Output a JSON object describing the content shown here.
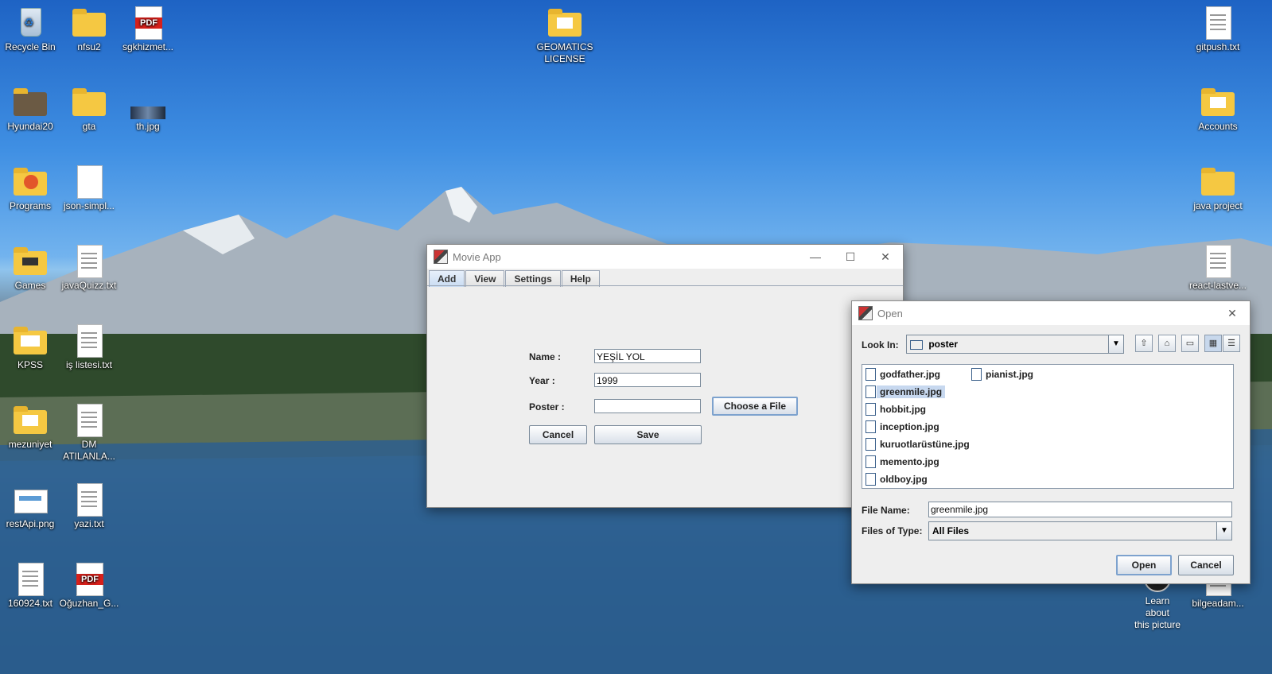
{
  "desktop": {
    "icons_left": [
      {
        "label": "Recycle Bin",
        "kind": "bin"
      },
      {
        "label": "nfsu2",
        "kind": "folder"
      },
      {
        "label": "sgkhizmet...",
        "kind": "pdf"
      },
      {
        "label": "Hyundai20",
        "kind": "folder"
      },
      {
        "label": "gta",
        "kind": "folder"
      },
      {
        "label": "th.jpg",
        "kind": "image"
      },
      {
        "label": "Programs",
        "kind": "folder"
      },
      {
        "label": "json-simpl...",
        "kind": "doc"
      },
      {
        "label": "Games",
        "kind": "folder"
      },
      {
        "label": "javaQuizz.txt",
        "kind": "doc"
      },
      {
        "label": "KPSS",
        "kind": "folder"
      },
      {
        "label": "iş listesi.txt",
        "kind": "doc"
      },
      {
        "label": "mezuniyet",
        "kind": "folder"
      },
      {
        "label": "DM ATILANLA...",
        "kind": "doc"
      },
      {
        "label": "restApi.png",
        "kind": "image"
      },
      {
        "label": "yazi.txt",
        "kind": "doc"
      },
      {
        "label": "160924.txt",
        "kind": "doc"
      },
      {
        "label": "Oğuzhan_G...",
        "kind": "pdf"
      }
    ],
    "icons_center": [
      {
        "label_line1": "GEOMATICS",
        "label_line2": "LICENSE",
        "kind": "folder"
      }
    ],
    "icons_right": [
      {
        "label": "gitpush.txt",
        "kind": "doc"
      },
      {
        "label": "Accounts",
        "kind": "folder"
      },
      {
        "label": "java project",
        "kind": "folder"
      },
      {
        "label": "react-lastve...",
        "kind": "doc"
      },
      {
        "label": "bilgeadam...",
        "kind": "doc"
      }
    ],
    "learn": {
      "line1": "Learn about",
      "line2": "this picture",
      "icon": "camera-icon"
    }
  },
  "movie_app": {
    "title": "Movie App",
    "tabs": [
      "Add",
      "View",
      "Settings",
      "Help"
    ],
    "active_tab": "Add",
    "form": {
      "name_label": "Name :",
      "name_value": "YEŞİL YOL",
      "year_label": "Year :",
      "year_value": "1999",
      "poster_label": "Poster :",
      "poster_value": "",
      "choose_label": "Choose a File",
      "cancel_label": "Cancel",
      "save_label": "Save"
    }
  },
  "open_dialog": {
    "title": "Open",
    "look_in_label": "Look In:",
    "look_in_value": "poster",
    "files_col1": [
      "godfather.jpg",
      "greenmile.jpg",
      "hobbit.jpg",
      "inception.jpg",
      "kuruotlarüstüne.jpg",
      "memento.jpg",
      "oldboy.jpg"
    ],
    "files_col2": [
      "pianist.jpg"
    ],
    "selected_file": "greenmile.jpg",
    "file_name_label": "File Name:",
    "file_name_value": "greenmile.jpg",
    "file_type_label": "Files of Type:",
    "file_type_value": "All Files",
    "open_label": "Open",
    "cancel_label": "Cancel"
  }
}
